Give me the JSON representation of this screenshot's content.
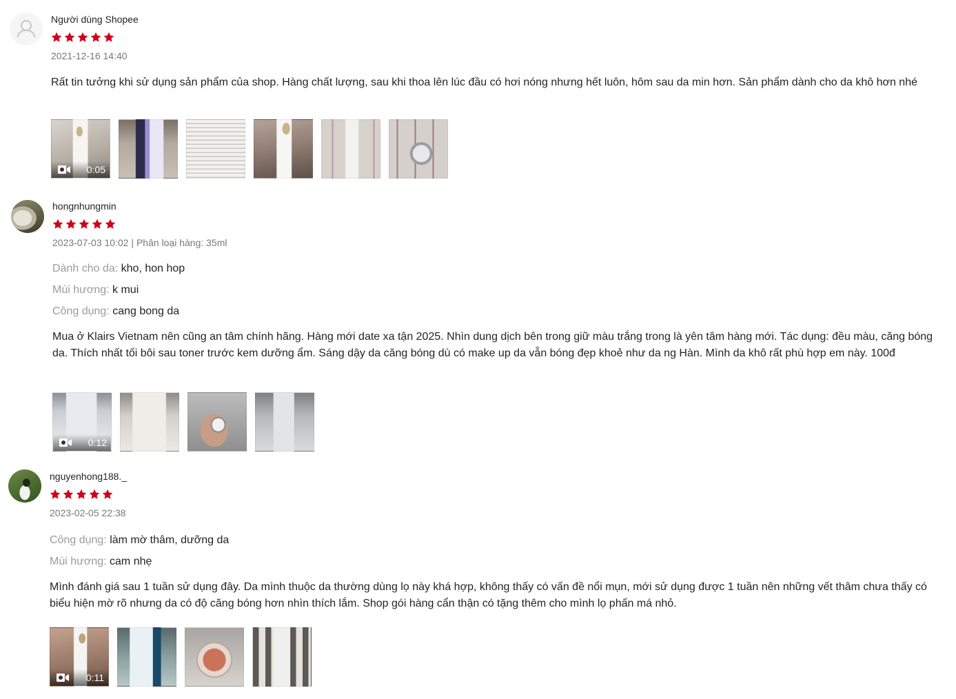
{
  "reviews": [
    {
      "username": "Người dùng Shopee",
      "rating": 5,
      "meta": "2021-12-16 14:40",
      "attributes": [],
      "comment": "Rất tin tưởng khi sử dụng sản phẩm của shop. Hàng chất lượng, sau khi thoa lên lúc đầu có hơi nóng nhưng hết luôn, hôm sau da min hơn. Sản phẩm dành cho da khô hơn nhé",
      "media": [
        {
          "type": "video",
          "duration": "0:05",
          "thumb": "bottle-light"
        },
        {
          "type": "image",
          "thumb": "box-purple"
        },
        {
          "type": "image",
          "thumb": "box-text"
        },
        {
          "type": "image",
          "thumb": "hand-bottle"
        },
        {
          "type": "image",
          "thumb": "check-bottle"
        },
        {
          "type": "image",
          "thumb": "dropper"
        }
      ]
    },
    {
      "username": "hongnhungmin",
      "rating": 5,
      "meta": "2023-07-03 10:02 | Phân loại hàng: 35ml",
      "attributes": [
        {
          "label": "Dành cho da:",
          "value": "kho, hon hop"
        },
        {
          "label": "Mùi hương:",
          "value": "k mui"
        },
        {
          "label": "Công dụng:",
          "value": "cang bong da"
        }
      ],
      "comment": "Mua ở Klairs Vietnam nên cũng an tâm chính hãng. Hàng mới date xa tận 2025. Nhìn dung dịch bên trong giữ màu trắng trong là yên tâm hàng mới. Tác dụng: đều màu, căng bóng da. Thích nhất tối bôi sau toner trước kem dưỡng ẩm. Sáng dậy da căng bóng dù có make up da vẫn bóng đẹp khoẻ như da ng Hàn. Mình da khô rất phù hợp em này. 100đ",
      "media": [
        {
          "type": "video",
          "duration": "0:12",
          "thumb": "bottle-klairs"
        },
        {
          "type": "image",
          "thumb": "bottle-box"
        },
        {
          "type": "image",
          "thumb": "hand-dark"
        },
        {
          "type": "image",
          "thumb": "bottle-side"
        }
      ]
    },
    {
      "username": "nguyenhong188._",
      "rating": 5,
      "meta": "2023-02-05 22:38",
      "attributes": [
        {
          "label": "Công dụng:",
          "value": "làm mờ thâm, dưỡng da"
        },
        {
          "label": "Mùi hương:",
          "value": "cam nhẹ"
        }
      ],
      "comment": "Mình đánh giá sau 1 tuần sử dụng đây. Da mình thuộc da thường dùng lọ này khá hợp, không thấy có vấn đề nổi mụn, mới sử dụng được 1 tuần nên những vết thâm chưa thấy có biểu hiện mờ rõ nhưng da có độ căng bóng hơn nhìn thích lắm. Shop gói hàng cẩn thận có tặng thêm cho mình lọ phấn má nhỏ.",
      "media": [
        {
          "type": "video",
          "duration": "0:11",
          "thumb": "hand-bottle2"
        },
        {
          "type": "image",
          "thumb": "box-blue"
        },
        {
          "type": "image",
          "thumb": "blush"
        },
        {
          "type": "image",
          "thumb": "bottle-plaid"
        }
      ]
    }
  ],
  "colors": {
    "star": "#d0011b",
    "muted": "#757575",
    "label": "#999999"
  }
}
